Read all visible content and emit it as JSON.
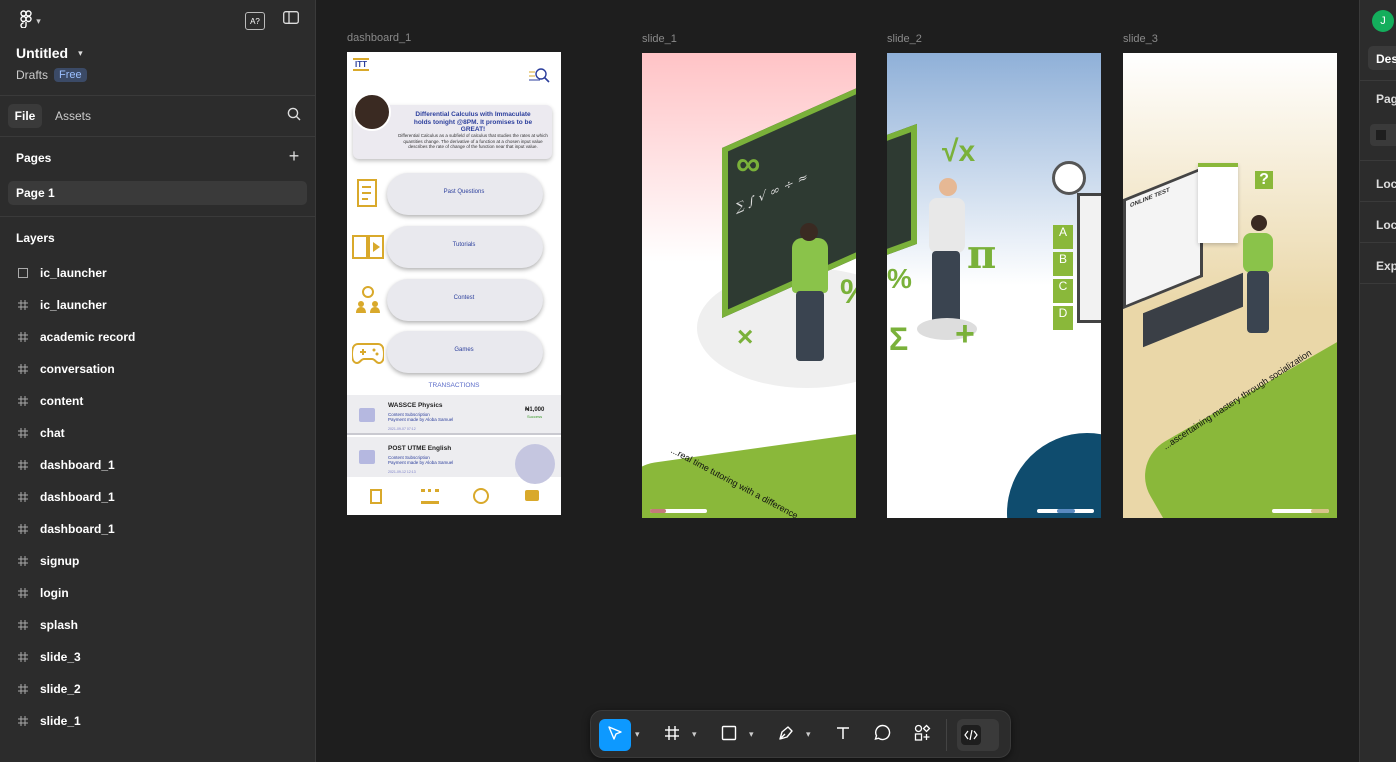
{
  "header": {
    "file_name": "Untitled",
    "location": "Drafts",
    "plan_badge": "Free"
  },
  "left_tabs": {
    "file": "File",
    "assets": "Assets"
  },
  "pages": {
    "heading": "Pages",
    "items": [
      {
        "label": "Page 1",
        "selected": true
      }
    ]
  },
  "layers": {
    "heading": "Layers",
    "items": [
      {
        "label": "ic_launcher",
        "icon": "square-icon"
      },
      {
        "label": "ic_launcher",
        "icon": "frame-icon"
      },
      {
        "label": "academic record",
        "icon": "frame-icon"
      },
      {
        "label": "conversation",
        "icon": "frame-icon"
      },
      {
        "label": "content",
        "icon": "frame-icon"
      },
      {
        "label": "chat",
        "icon": "frame-icon"
      },
      {
        "label": "dashboard_1",
        "icon": "frame-icon"
      },
      {
        "label": "dashboard_1",
        "icon": "frame-icon"
      },
      {
        "label": "dashboard_1",
        "icon": "frame-icon"
      },
      {
        "label": "signup",
        "icon": "frame-icon"
      },
      {
        "label": "login",
        "icon": "frame-icon"
      },
      {
        "label": "splash",
        "icon": "frame-icon"
      },
      {
        "label": "slide_3",
        "icon": "frame-icon"
      },
      {
        "label": "slide_2",
        "icon": "frame-icon"
      },
      {
        "label": "slide_1",
        "icon": "frame-icon"
      }
    ]
  },
  "canvas": {
    "frames": [
      {
        "label": "dashboard_1"
      },
      {
        "label": "slide_1"
      },
      {
        "label": "slide_2"
      },
      {
        "label": "slide_3"
      }
    ],
    "dashboard": {
      "logo": "ITT",
      "banner_title": "Differential Calculus with Immaculate holds tonight @8PM. It promises to be GREAT!",
      "banner_body": "Differential Calculus as a subfield of calculus that studies the rates at which quantities change. The derivative of a function at a chosen input value describes the rate of change of the function near that input value.",
      "menu": [
        "Past Questions",
        "Tutorials",
        "Contest",
        "Games"
      ],
      "transactions_heading": "TRANSACTIONS",
      "transactions": [
        {
          "title": "WASSCE Physics",
          "type": "Content Subscription",
          "desc": "Payment made by Aloba Samuel",
          "date": "2021-09-07 07:12",
          "amount": "₦1,000",
          "status": "Success"
        },
        {
          "title": "POST UTME English",
          "type": "Content Subscription",
          "desc": "Payment made by Aloba Samuel",
          "date": "2021-09-12 12:13",
          "amount": "",
          "status": ""
        }
      ]
    },
    "slide_1": {
      "caption": "...real time tutoring with a difference"
    },
    "slide_2": {
      "caption": ""
    },
    "slide_3": {
      "caption": "...ascertaining mastery through socialization",
      "screen_title": "ONLINE TEST"
    }
  },
  "right_panel": {
    "avatar_initial": "J",
    "tab": "Design",
    "sections": [
      "Page",
      "Local variables",
      "Local styles",
      "Export"
    ]
  },
  "colors": {
    "accent": "#0d99ff",
    "green": "#8ab83a",
    "badge_bg": "#3b4a66",
    "badge_text": "#9cc0ff",
    "avatar": "#14ae5c"
  }
}
